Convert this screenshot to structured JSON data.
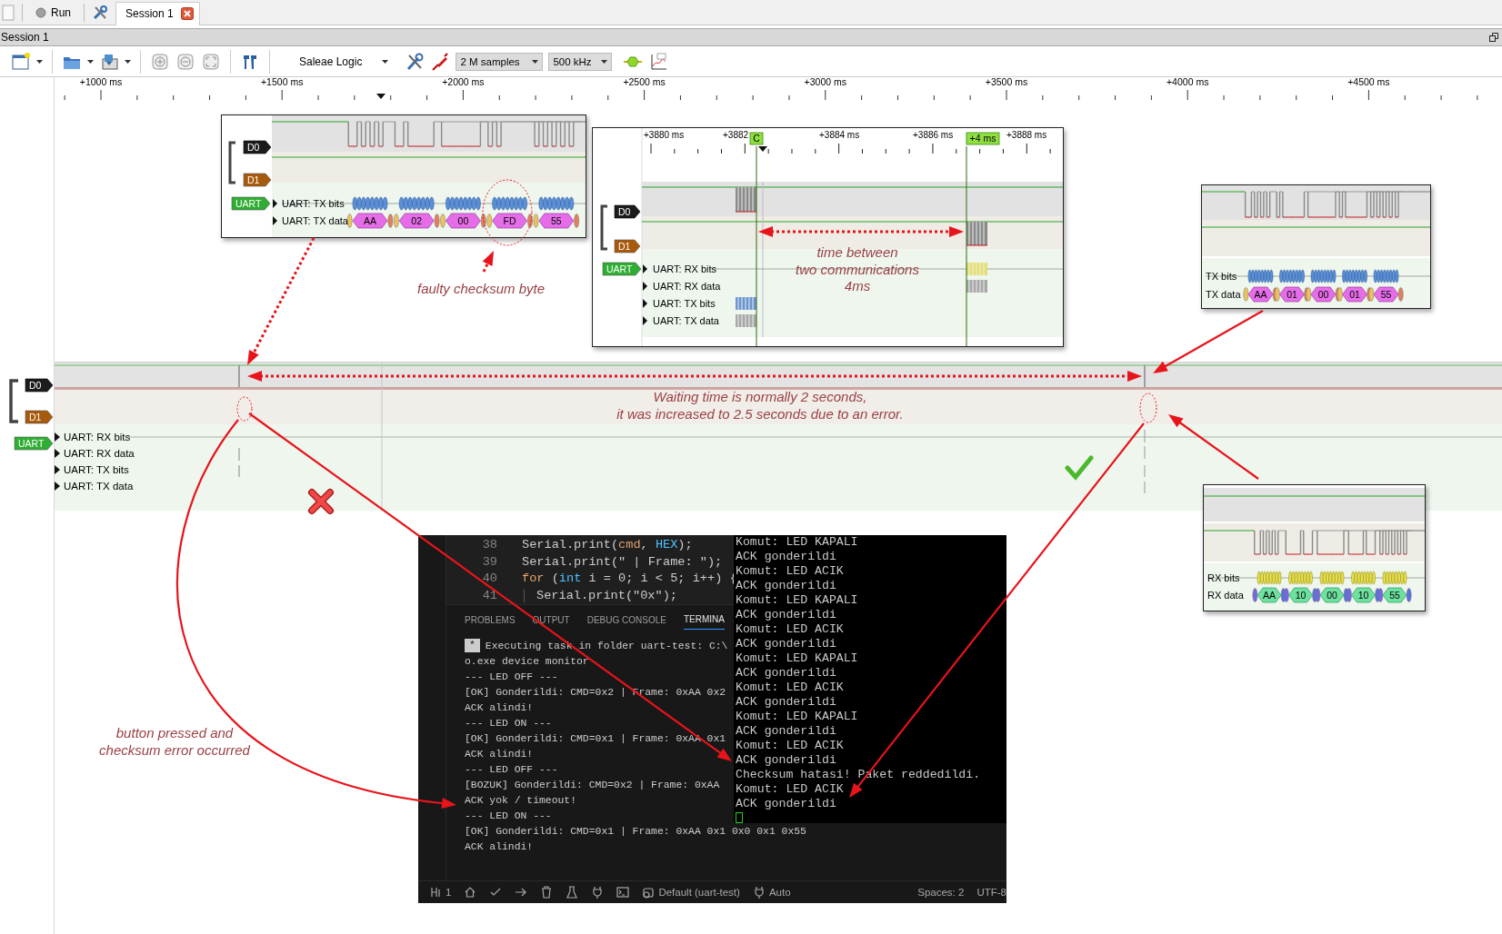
{
  "tab_bar": {
    "run_button": "Run",
    "tabs": [
      {
        "label": "Session 1",
        "selected": true
      }
    ]
  },
  "session_bar": {
    "title": "Session 1"
  },
  "toolbar": {
    "device": "Saleae Logic",
    "samples": "2 M samples",
    "sample_rate": "500 kHz"
  },
  "ruler": {
    "labels": [
      "+1000 ms",
      "+1500 ms",
      "+2000 ms",
      "+2500 ms",
      "+3000 ms",
      "+3500 ms",
      "+4000 ms",
      "+4500 ms"
    ]
  },
  "channels": [
    {
      "label": "D0"
    },
    {
      "label": "D1"
    }
  ],
  "analyzer": {
    "label": "UART",
    "rows": [
      "UART: RX bits",
      "UART: RX data",
      "UART: TX bits",
      "UART: TX data"
    ]
  },
  "insets": [
    {
      "kind": "tx_frames",
      "channels": [
        "D0",
        "D1"
      ],
      "analyzer": "UART",
      "rows": [
        "UART: TX bits",
        "UART: TX data"
      ],
      "frames": [
        "AA",
        "02",
        "00",
        "FD",
        "55"
      ]
    },
    {
      "kind": "zoom",
      "ruler": [
        "+3880 ms",
        "+3882",
        "+3884 ms",
        "+3886 ms",
        "+3888 ms"
      ],
      "markers": [
        "C",
        "+4 ms"
      ],
      "channels": [
        "D0",
        "D1"
      ],
      "analyzer": "UART",
      "rows": [
        "UART: RX bits",
        "UART: RX data",
        "UART: TX bits",
        "UART: TX data"
      ]
    },
    {
      "kind": "tx_frames",
      "rows": [
        "TX bits",
        "TX data"
      ],
      "frames": [
        "AA",
        "01",
        "00",
        "01",
        "55"
      ]
    },
    {
      "kind": "rx_frames",
      "rows": [
        "RX bits",
        "RX data"
      ],
      "frames": [
        "AA",
        "10",
        "00",
        "10",
        "55"
      ]
    }
  ],
  "annotations": [
    {
      "lines": [
        "faulty checksum byte"
      ]
    },
    {
      "lines": [
        "time between",
        "two communications",
        "4ms"
      ]
    },
    {
      "lines": [
        "Waiting time is normally 2 seconds,",
        "it was increased to 2.5 seconds due to an error."
      ]
    },
    {
      "lines": [
        "button pressed and",
        "checksum error occurred"
      ]
    }
  ],
  "editor": {
    "lines": [
      {
        "number": "38",
        "tokens": [
          {
            "text": "Serial.print(",
            "kind": "plain"
          },
          {
            "text": "cmd",
            "kind": "variable"
          },
          {
            "text": ", ",
            "kind": "plain"
          },
          {
            "text": "HEX",
            "kind": "constant"
          },
          {
            "text": ");",
            "kind": "plain"
          }
        ]
      },
      {
        "number": "39",
        "tokens": [
          {
            "text": "Serial.print(\" | Frame: \");",
            "kind": "plain"
          }
        ]
      },
      {
        "number": "40",
        "tokens": [
          {
            "text": "for",
            "kind": "keyword"
          },
          {
            "text": " (",
            "kind": "plain"
          },
          {
            "text": "int",
            "kind": "constant"
          },
          {
            "text": " i = 0; i < 5; i++) {",
            "kind": "plain"
          }
        ]
      },
      {
        "number": "41",
        "indented": true,
        "tokens": [
          {
            "text": "Serial.print(\"0x\");",
            "kind": "plain"
          }
        ]
      }
    ]
  },
  "terminal": {
    "tabs": [
      {
        "label": "PROBLEMS",
        "selected": false
      },
      {
        "label": "OUTPUT",
        "selected": false
      },
      {
        "label": "DEBUG CONSOLE",
        "selected": false
      },
      {
        "label": "TERMINA",
        "selected": true
      }
    ],
    "badge": "*",
    "lines": [
      "Executing task in folder uart-test: C:\\",
      "o.exe device monitor",
      "--- LED OFF ---",
      "[OK] Gonderildi: CMD=0x2 | Frame: 0xAA 0x2",
      "ACK alindi!",
      "--- LED ON ---",
      "[OK] Gonderildi: CMD=0x1 | Frame: 0xAA 0x1",
      "ACK alindi!",
      "--- LED OFF ---",
      "[BOZUK] Gonderildi: CMD=0x2 | Frame: 0xAA",
      "ACK yok / timeout!",
      "--- LED ON ---",
      "[OK] Gonderildi: CMD=0x1 | Frame: 0xAA 0x1 0x0 0x1 0x55",
      "ACK alindi!"
    ]
  },
  "serial_monitor": {
    "lines": [
      "Komut: LED KAPALI",
      "ACK gonderildi",
      "Komut: LED ACIK",
      "ACK gonderildi",
      "Komut: LED KAPALI",
      "ACK gonderildi",
      "Komut: LED ACIK",
      "ACK gonderildi",
      "Komut: LED KAPALI",
      "ACK gonderildi",
      "Komut: LED ACIK",
      "ACK gonderildi",
      "Komut: LED KAPALI",
      "ACK gonderildi",
      "Komut: LED ACIK",
      "ACK gonderildi",
      "Checksum hatasi! Paket reddedildi.",
      "Komut: LED ACIK",
      "ACK gonderildi"
    ]
  },
  "status_bar": {
    "ports": "1",
    "profile": "Default (uart-test)",
    "mode": "Auto",
    "spaces": "Spaces: 2",
    "encoding": "UTF-8"
  }
}
